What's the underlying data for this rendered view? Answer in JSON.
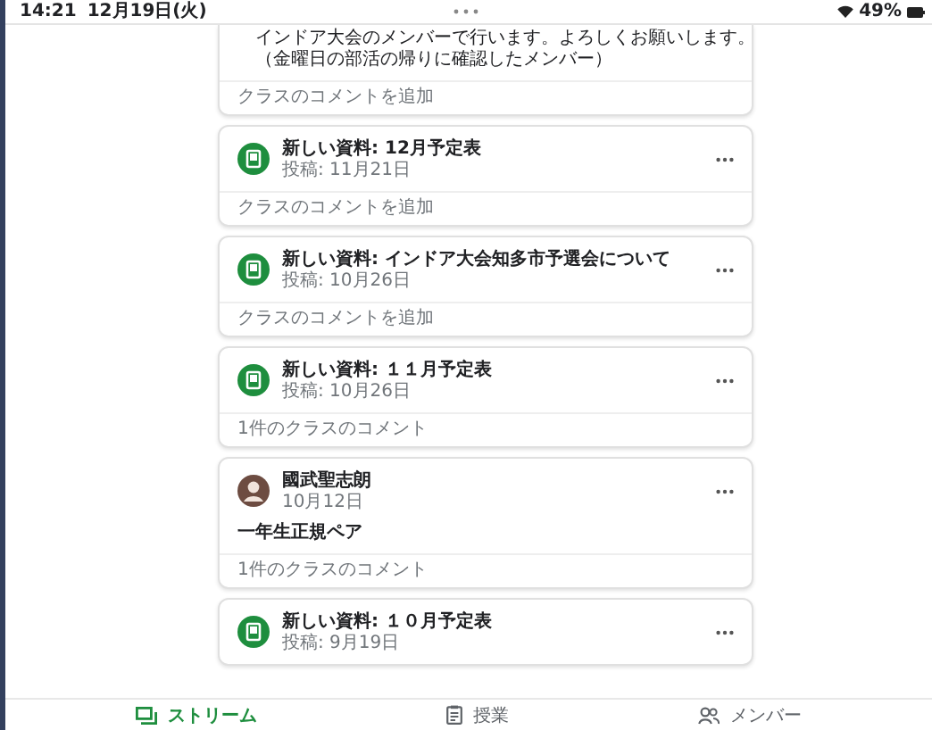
{
  "status_bar": {
    "time": "14:21",
    "date": "12月19日(火)",
    "battery": "49%"
  },
  "posts": [
    {
      "kind": "announcement",
      "body": [
        "インドア大会のメンバーで行います。よろしくお願いします。",
        "（金曜日の部活の帰りに確認したメンバー）"
      ],
      "comment": "クラスのコメントを追加"
    },
    {
      "kind": "material",
      "title": "新しい資料: 12月予定表",
      "date": "投稿: 11月21日",
      "comment": "クラスのコメントを追加"
    },
    {
      "kind": "material",
      "title": "新しい資料: インドア大会知多市予選会について",
      "date": "投稿: 10月26日",
      "comment": "クラスのコメントを追加"
    },
    {
      "kind": "material",
      "title": "新しい資料: １１月予定表",
      "date": "投稿: 10月26日",
      "comment": "1件のクラスのコメント"
    },
    {
      "kind": "announcement",
      "author": "國武聖志朗",
      "date": "10月12日",
      "body": [
        "一年生正規ペア"
      ],
      "comment": "1件のクラスのコメント"
    },
    {
      "kind": "material",
      "title": "新しい資料: １０月予定表",
      "date": "投稿: 9月19日"
    }
  ],
  "nav": [
    {
      "kind": "stream",
      "label": "ストリーム",
      "selected": true
    },
    {
      "kind": "classwork",
      "label": "授業",
      "selected": false
    },
    {
      "kind": "people",
      "label": "メンバー",
      "selected": false
    }
  ]
}
